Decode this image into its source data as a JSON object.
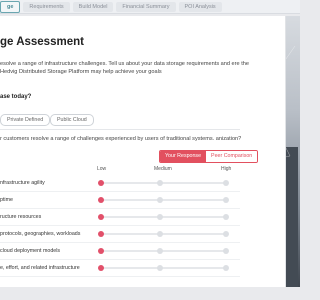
{
  "nav": {
    "tabs": [
      {
        "label": "ge"
      },
      {
        "label": "Requirements"
      },
      {
        "label": "Build Model"
      },
      {
        "label": "Financial Summary"
      },
      {
        "label": "POI Analysis"
      }
    ],
    "active_index": 0
  },
  "page": {
    "title": "ge Assessment",
    "intro": "esolve a range of infrastructure challenges. Tell us about your data storage requirements and ere the Hedvig Distributed Storage Platform may help achieve your goals",
    "question1": "ase today?",
    "chips": [
      "Private Defined",
      "Public Cloud"
    ],
    "question2": "r customers resolve a range of challenges experienced by users of traditional systems. anization?"
  },
  "toggle": {
    "on_label": "Your Response",
    "off_label": "Peer Comparison"
  },
  "scale": {
    "low": "Low",
    "medium": "Medium",
    "high": "High"
  },
  "rows": [
    {
      "label": "nfrastructure agility",
      "level": "low"
    },
    {
      "label": "ptime",
      "level": "low"
    },
    {
      "label": "ructure resources",
      "level": "low"
    },
    {
      "label": "protocols, geographies, workloads",
      "level": "low"
    },
    {
      "label": "cloud deployment models",
      "level": "low"
    },
    {
      "label": "e, effort, and related infrastructure",
      "level": "low"
    }
  ],
  "colors": {
    "accent": "#e2506a",
    "active_tab": "#4c8b96"
  }
}
